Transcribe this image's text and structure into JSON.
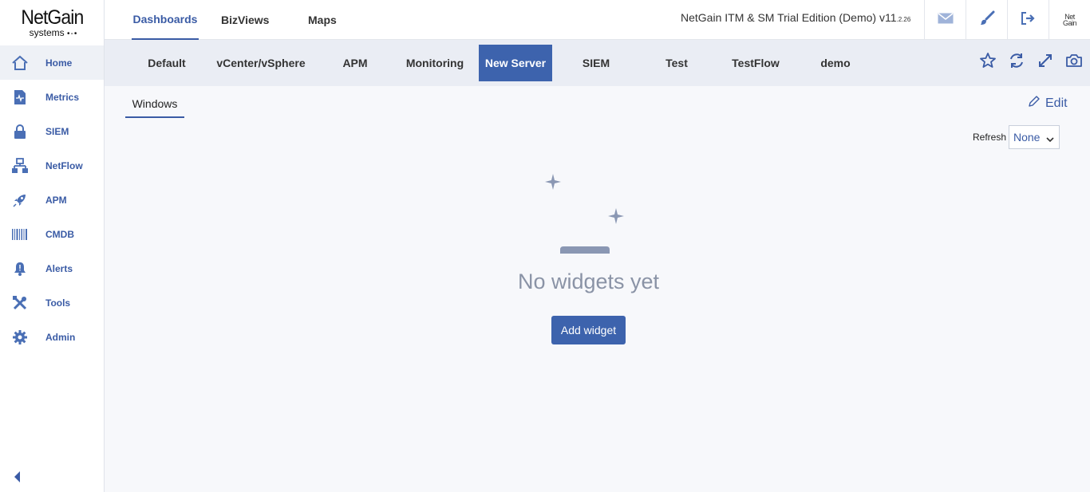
{
  "logo": {
    "name": "NetGain",
    "sub": "systems"
  },
  "sidebar": {
    "items": [
      {
        "label": "Home",
        "icon": "home-icon"
      },
      {
        "label": "Metrics",
        "icon": "metrics-icon"
      },
      {
        "label": "SIEM",
        "icon": "lock-icon"
      },
      {
        "label": "NetFlow",
        "icon": "network-icon"
      },
      {
        "label": "APM",
        "icon": "rocket-icon"
      },
      {
        "label": "CMDB",
        "icon": "barcode-icon"
      },
      {
        "label": "Alerts",
        "icon": "bell-icon"
      },
      {
        "label": "Tools",
        "icon": "tools-icon"
      },
      {
        "label": "Admin",
        "icon": "gear-icon"
      }
    ],
    "active": "Home"
  },
  "topnav": {
    "tabs": [
      "Dashboards",
      "BizViews",
      "Maps"
    ],
    "active": "Dashboards",
    "edition": "NetGain ITM & SM Trial Edition (Demo) v11",
    "version_suffix": ".2.26",
    "icons": [
      "mail-icon",
      "brush-icon",
      "logout-icon",
      "user-avatar"
    ]
  },
  "dashboards": {
    "tabs": [
      "Default",
      "vCenter/vSphere",
      "APM",
      "Monitoring",
      "New Server",
      "SIEM",
      "Test",
      "TestFlow",
      "demo"
    ],
    "active": "New Server",
    "actions": [
      "star-icon",
      "refresh-icon",
      "expand-icon",
      "camera-icon"
    ]
  },
  "content": {
    "subtab": "Windows",
    "edit_label": "Edit",
    "refresh_label": "Refresh",
    "refresh_value": "None",
    "empty_title": "No widgets yet",
    "add_widget_label": "Add widget"
  },
  "colors": {
    "accent": "#3d63ad",
    "icon": "#4a6fb5",
    "muted": "#8a93a6"
  }
}
